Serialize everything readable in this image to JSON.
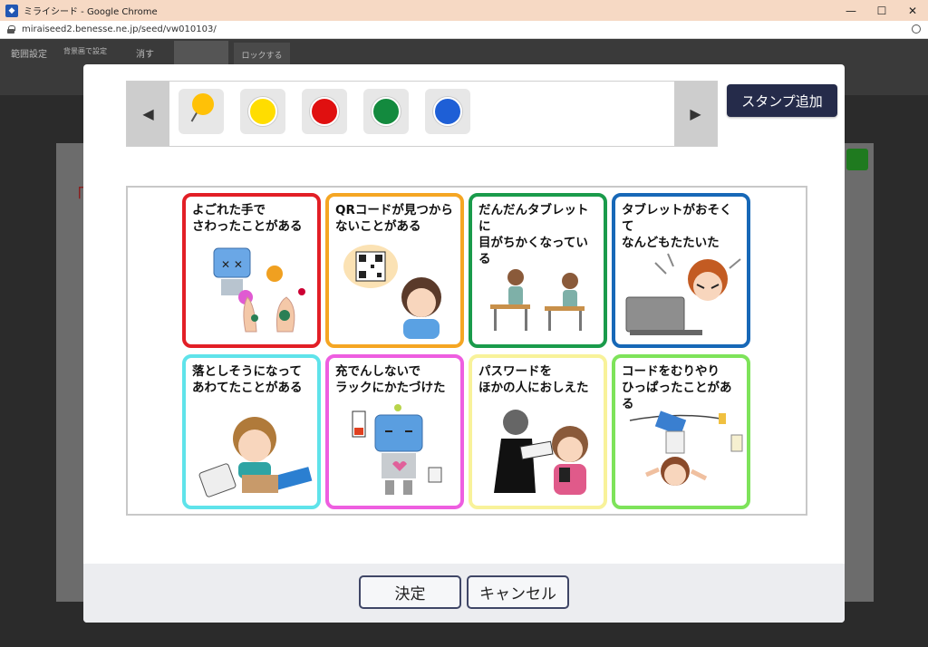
{
  "window": {
    "title": "ミライシード - Google Chrome",
    "url": "miraiseed2.benesse.ne.jp/seed/vw010103/",
    "controls": {
      "minimize": "—",
      "maximize": "☐",
      "close": "✕"
    }
  },
  "app_toolbar": {
    "range_setting": "範囲設定",
    "set_as_background": "背景画で設定",
    "erase": "消す",
    "lock": "ロックする"
  },
  "modal": {
    "add_stamp_label": "スタンプ追加",
    "palette": {
      "prev_arrow": "◀",
      "next_arrow": "▶",
      "stamps": [
        {
          "icon": "pin-icon",
          "color": "#ffc107"
        },
        {
          "icon": "circle-icon",
          "color": "#ffdd00"
        },
        {
          "icon": "circle-icon",
          "color": "#e01010"
        },
        {
          "icon": "circle-icon",
          "color": "#138a3e"
        },
        {
          "icon": "circle-icon",
          "color": "#1e5fd6"
        }
      ]
    },
    "cards": [
      {
        "text": "よごれた手で\nさわったことがある",
        "border": "#e21f26"
      },
      {
        "text": "QRコードが見つから\nないことがある",
        "border": "#f5a623"
      },
      {
        "text": "だんだんタブレットに\n目がちかくなっている",
        "border": "#1a9b4b"
      },
      {
        "text": "タブレットがおそくて\nなんどもたたいた",
        "border": "#1768b7"
      },
      {
        "text": "落としそうになって\nあわてたことがある",
        "border": "#5fe3ea"
      },
      {
        "text": "充でんしないで\nラックにかたづけた",
        "border": "#ee5ee0"
      },
      {
        "text": "パスワードを\nほかの人におしえた",
        "border": "#f8f29a"
      },
      {
        "text": "コードをむりやり\nひっぱったことがある",
        "border": "#7ee35a"
      }
    ],
    "ok_label": "決定",
    "cancel_label": "キャンセル"
  }
}
